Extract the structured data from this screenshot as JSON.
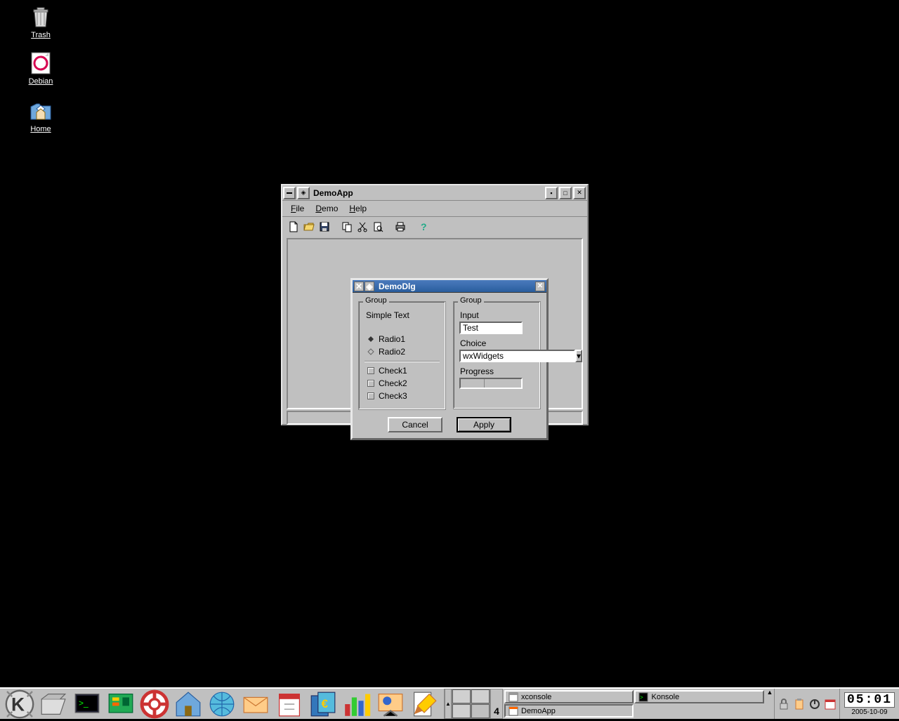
{
  "desktop": {
    "icons": [
      {
        "name": "trash",
        "label": "Trash"
      },
      {
        "name": "debian",
        "label": "Debian"
      },
      {
        "name": "home",
        "label": "Home"
      }
    ]
  },
  "app_window": {
    "title": "DemoApp",
    "menus": [
      {
        "label": "File",
        "accel": "F"
      },
      {
        "label": "Demo",
        "accel": "D"
      },
      {
        "label": "Help",
        "accel": "H"
      }
    ],
    "toolbar": [
      "new",
      "open",
      "save",
      "copy",
      "cut",
      "preview",
      "print",
      "help"
    ]
  },
  "dialog": {
    "title": "DemoDlg",
    "left_group": {
      "legend": "Group",
      "static_text": "Simple Text",
      "radios": [
        {
          "label": "Radio1",
          "selected": true
        },
        {
          "label": "Radio2",
          "selected": false
        }
      ],
      "checks": [
        {
          "label": "Check1",
          "checked": false
        },
        {
          "label": "Check2",
          "checked": false
        },
        {
          "label": "Check3",
          "checked": false
        }
      ]
    },
    "right_group": {
      "legend": "Group",
      "input_label": "Input",
      "input_value": "Test",
      "choice_label": "Choice",
      "choice_value": "wxWidgets",
      "progress_label": "Progress",
      "progress_percent": 40
    },
    "buttons": {
      "cancel": "Cancel",
      "apply": "Apply"
    }
  },
  "taskbar": {
    "pager_active": 4,
    "tasks": [
      {
        "label": "xconsole",
        "active": false
      },
      {
        "label": "Konsole",
        "active": false
      },
      {
        "label": "DemoApp",
        "active": true
      }
    ],
    "clock": {
      "time": "05:01",
      "date": "2005-10-09"
    }
  }
}
